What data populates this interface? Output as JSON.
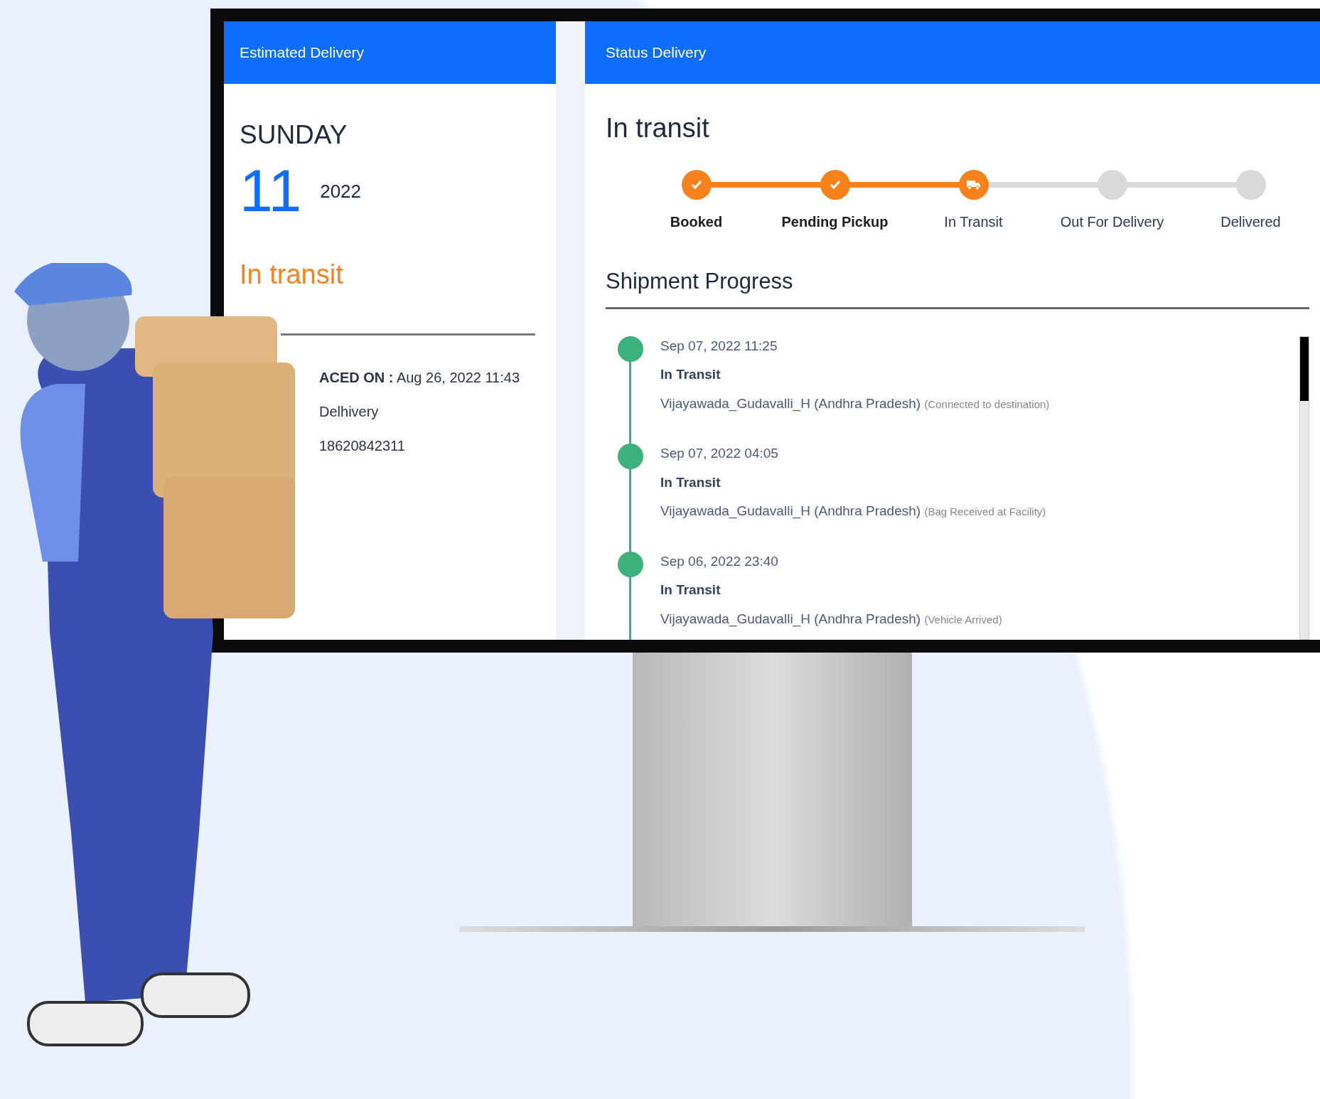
{
  "estimated_delivery": {
    "header": "Estimated Delivery",
    "day": "SUNDAY",
    "date": "11",
    "year": "2022",
    "status": "In transit",
    "details": [
      "**ACED ON :** Aug 26, 2022 11:43",
      "Delhivery",
      "18620842311"
    ]
  },
  "status_delivery": {
    "header": "Status Delivery",
    "title": "In transit",
    "steps": [
      {
        "label": "Booked",
        "kind": "done"
      },
      {
        "label": "Pending Pickup",
        "kind": "done"
      },
      {
        "label": "In Transit",
        "kind": "current"
      },
      {
        "label": "Out For Delivery",
        "kind": "pending"
      },
      {
        "label": "Delivered",
        "kind": "pending"
      }
    ],
    "progress_title": "Shipment Progress",
    "events": [
      {
        "time": "Sep 07, 2022 11:25",
        "status": "In Transit",
        "location": "Vijayawada_Gudavalli_H (Andhra Pradesh)",
        "note": "(Connected to destination)"
      },
      {
        "time": "Sep 07, 2022 04:05",
        "status": "In Transit",
        "location": "Vijayawada_Gudavalli_H (Andhra Pradesh)",
        "note": "(Bag Received at Facility)"
      },
      {
        "time": "Sep 06, 2022 23:40",
        "status": "In Transit",
        "location": "Vijayawada_Gudavalli_H (Andhra Pradesh)",
        "note": "(Vehicle Arrived)"
      }
    ]
  }
}
